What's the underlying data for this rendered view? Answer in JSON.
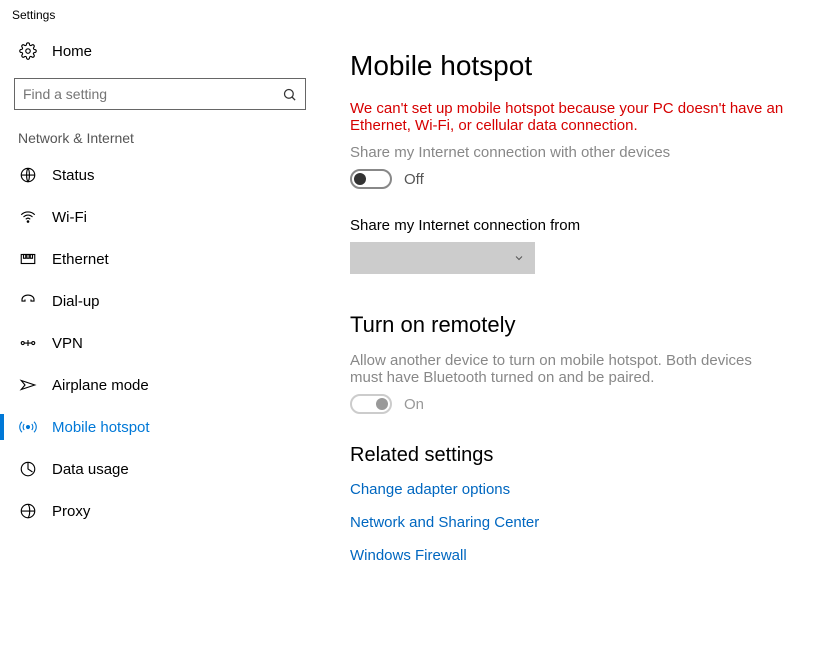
{
  "window": {
    "title": "Settings"
  },
  "sidebar": {
    "home_label": "Home",
    "search_placeholder": "Find a setting",
    "category_heading": "Network & Internet",
    "items": [
      {
        "label": "Status"
      },
      {
        "label": "Wi-Fi"
      },
      {
        "label": "Ethernet"
      },
      {
        "label": "Dial-up"
      },
      {
        "label": "VPN"
      },
      {
        "label": "Airplane mode"
      },
      {
        "label": "Mobile hotspot"
      },
      {
        "label": "Data usage"
      },
      {
        "label": "Proxy"
      }
    ]
  },
  "main": {
    "page_title": "Mobile hotspot",
    "error_message": "We can't set up mobile hotspot because your PC doesn't have an Ethernet, Wi-Fi, or cellular data connection.",
    "share_label": "Share my Internet connection with other devices",
    "share_toggle_state": "Off",
    "share_from_label": "Share my Internet connection from",
    "remote_section_title": "Turn on remotely",
    "remote_description": "Allow another device to turn on mobile hotspot. Both devices must have Bluetooth turned on and be paired.",
    "remote_toggle_state": "On",
    "related_heading": "Related settings",
    "links": [
      "Change adapter options",
      "Network and Sharing Center",
      "Windows Firewall"
    ]
  }
}
